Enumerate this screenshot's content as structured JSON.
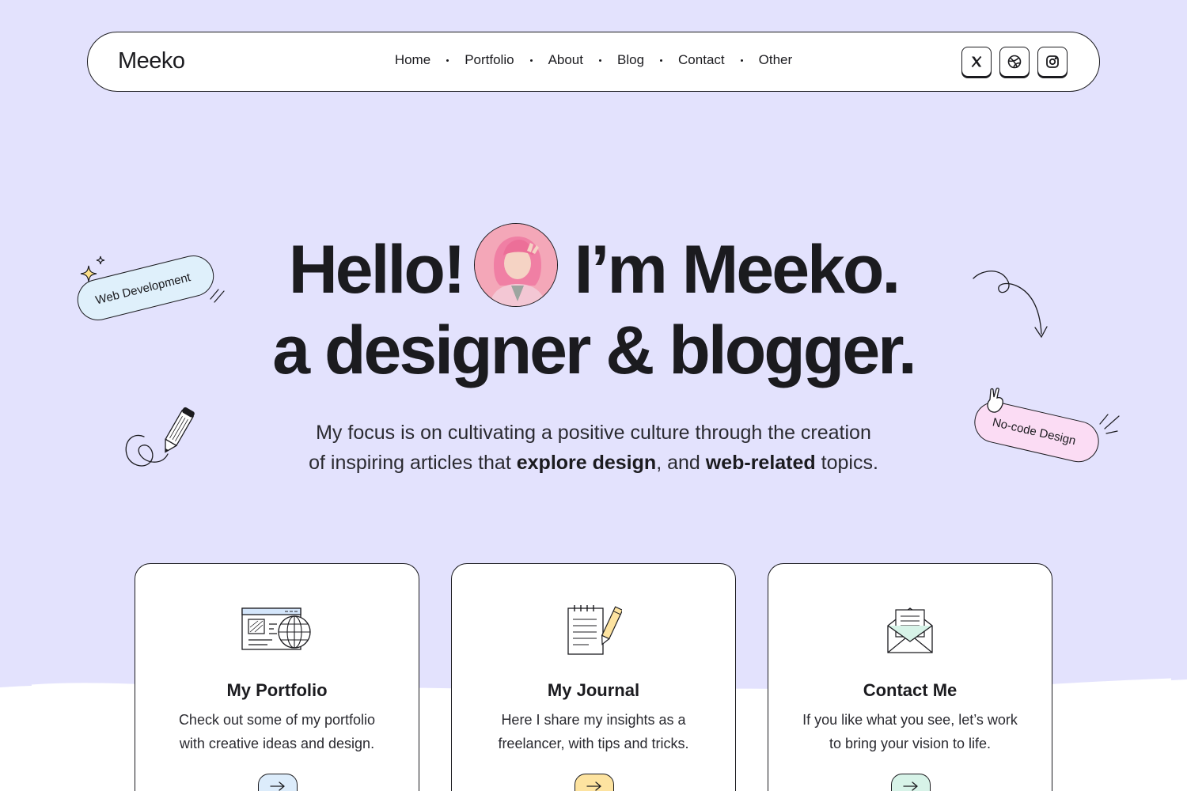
{
  "nav": {
    "logo": "Meeko",
    "links": [
      "Home",
      "Portfolio",
      "About",
      "Blog",
      "Contact",
      "Other"
    ],
    "socials": [
      "x-icon",
      "dribbble-icon",
      "instagram-icon"
    ]
  },
  "hero": {
    "line1_start": "Hello!",
    "line1_end": "I’m Meeko.",
    "line2": "a designer & blogger.",
    "sub_line1": "My focus is on cultivating a positive culture through the creation",
    "sub_line2_a": "of inspiring articles that ",
    "sub_line2_b": "explore design",
    "sub_line2_c": ", and ",
    "sub_line2_d": "web-related",
    "sub_line2_e": " topics."
  },
  "tags": {
    "web": "Web Development",
    "nocode": "No-code Design"
  },
  "cards": [
    {
      "title": "My Portfolio",
      "desc": "Check out some of my portfolio with creative ideas and design.",
      "icon": "browser-globe-icon",
      "button_color": "#dcecfb"
    },
    {
      "title": "My Journal",
      "desc": "Here I share my insights as a freelancer, with tips and tricks.",
      "icon": "notepad-pencil-icon",
      "button_color": "#fde3a0"
    },
    {
      "title": "Contact Me",
      "desc": "If you like what you see, let’s work to bring your vision to life.",
      "icon": "envelope-letter-icon",
      "button_color": "#d7f3e8"
    }
  ],
  "colors": {
    "background": "#e3e2fd",
    "text": "#1b1b1f",
    "web_tag": "#dff0fb",
    "nocode_tag": "#fbdcf4"
  }
}
